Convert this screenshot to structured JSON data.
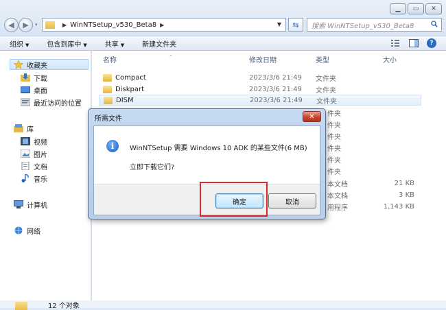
{
  "window": {
    "controls": [
      "minimize",
      "maximize",
      "close"
    ]
  },
  "address": {
    "path": "WinNTSetup_v530_Beta8",
    "search_placeholder": "搜索 WinNTSetup_v530_Beta8"
  },
  "toolbar": {
    "organize": "组织",
    "include_library": "包含到库中",
    "share": "共享",
    "new_folder": "新建文件夹"
  },
  "nav": {
    "favorites": "收藏夹",
    "downloads": "下载",
    "desktop": "桌面",
    "recent": "最近访问的位置",
    "libraries": "库",
    "videos": "视频",
    "pictures": "图片",
    "documents": "文档",
    "music": "音乐",
    "computer": "计算机",
    "network": "网络"
  },
  "columns": {
    "name": "名称",
    "date": "修改日期",
    "type": "类型",
    "size": "大小"
  },
  "files": [
    {
      "name": "Compact",
      "date": "2023/3/6 21:49",
      "type": "文件夹",
      "size": ""
    },
    {
      "name": "Diskpart",
      "date": "2023/3/6 21:49",
      "type": "文件夹",
      "size": ""
    },
    {
      "name": "DISM",
      "date": "2023/3/6 21:49",
      "type": "文件夹",
      "size": ""
    }
  ],
  "hidden_rows": [
    {
      "type": "件夹",
      "size": ""
    },
    {
      "type": "件夹",
      "size": ""
    },
    {
      "type": "件夹",
      "size": ""
    },
    {
      "type": "件夹",
      "size": ""
    },
    {
      "type": "件夹",
      "size": ""
    },
    {
      "type": "件夹",
      "size": ""
    },
    {
      "type": "本文档",
      "size": "21 KB"
    },
    {
      "type": "本文档",
      "size": "3 KB"
    },
    {
      "type": "用程序",
      "size": "1,143 KB"
    }
  ],
  "status": {
    "count": "12 个对象"
  },
  "dialog": {
    "title": "所需文件",
    "message": "WinNTSetup 需要 Windows 10 ADK 的某些文件(6 MB)",
    "question": "立即下载它们?",
    "ok": "确定",
    "cancel": "取消"
  },
  "colors": {
    "highlight": "#e0262c",
    "close_button": "#c6452f"
  }
}
